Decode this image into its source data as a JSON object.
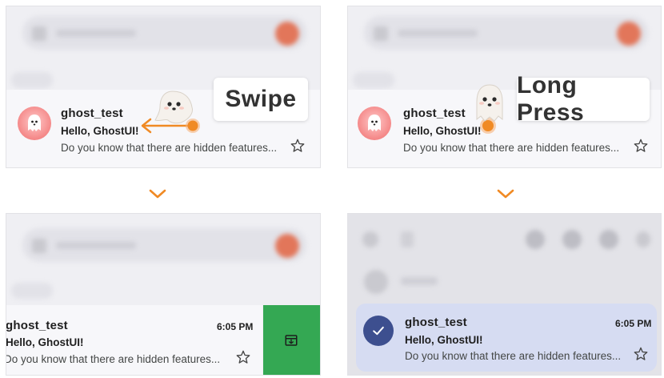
{
  "email": {
    "sender": "ghost_test",
    "subject": "Hello, GhostUI!",
    "snippet": "Do you know that there are hidden features...",
    "time": "6:05 PM"
  },
  "labels": {
    "swipe": "Swipe",
    "long_press": "Long Press"
  },
  "colors": {
    "accent_orange": "#f08a24",
    "archive_green": "#34a853",
    "selected_row": "#d6dcf2",
    "check_avatar": "#3d4f8f"
  },
  "icons": {
    "chevron": "chevron-down-icon",
    "star": "star-icon",
    "archive": "archive-icon",
    "check": "check-icon",
    "ghost": "ghost-icon"
  }
}
